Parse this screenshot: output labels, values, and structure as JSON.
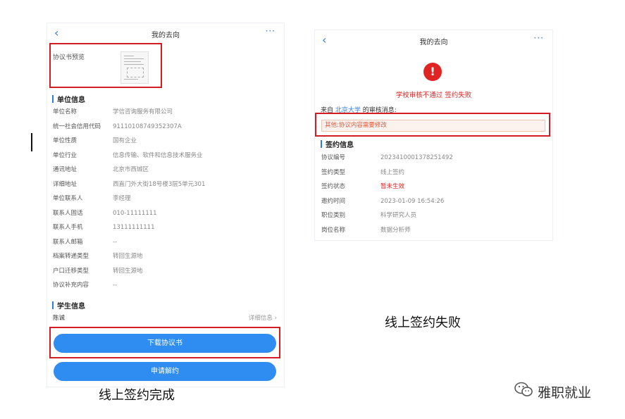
{
  "left": {
    "nav": {
      "back": "‹",
      "title": "我的去向",
      "more": "···"
    },
    "preview_label": "协议书预览",
    "unit_section": "单位信息",
    "unit_fields": [
      {
        "k": "单位名称",
        "v": "学信咨询服务有限公司"
      },
      {
        "k": "统一社会信用代码",
        "v": "91110108749352307A"
      },
      {
        "k": "单位性质",
        "v": "国有企业"
      },
      {
        "k": "单位行业",
        "v": "信息传输、软件和信息技术服务业"
      },
      {
        "k": "通讯地址",
        "v": "北京市西城区"
      },
      {
        "k": "详细地址",
        "v": "西直门外大街18号楼3层5单元301"
      },
      {
        "k": "单位联系人",
        "v": "李经理"
      },
      {
        "k": "联系人固话",
        "v": "010-11111111"
      },
      {
        "k": "联系人手机",
        "v": "13111111111"
      },
      {
        "k": "联系人邮箱",
        "v": "--"
      },
      {
        "k": "档案转递类型",
        "v": "转回生源地"
      },
      {
        "k": "户口迁移类型",
        "v": "转回生源地"
      },
      {
        "k": "协议补充内容",
        "v": "--"
      }
    ],
    "student_section": "学生信息",
    "student_name": "陈诚",
    "student_detail": "详细信息 ›",
    "download_btn": "下载协议书",
    "cancel_btn": "申请解约",
    "caption": "线上签约完成"
  },
  "right": {
    "nav": {
      "back": "‹",
      "title": "我的去向",
      "more": "···"
    },
    "alert_glyph": "!",
    "fail_text": "学校审核不通过 签约失败",
    "review_prefix": "来自 ",
    "review_school": "北京大学",
    "review_suffix": " 的审核消息:",
    "review_message": "其他:协议内容需要修改",
    "sign_section": "签约信息",
    "sign_fields": [
      {
        "k": "协议编号",
        "v": "2023410001378251492"
      },
      {
        "k": "签约类型",
        "v": "线上签约"
      },
      {
        "k": "签约状态",
        "v": "暂未生效"
      },
      {
        "k": "邀约时间",
        "v": "2023-01-09 16:54:26"
      },
      {
        "k": "职位类别",
        "v": "科学研究人员"
      },
      {
        "k": "岗位名称",
        "v": "数据分析师"
      }
    ],
    "caption": "线上签约失败"
  },
  "watermark": "雅职就业",
  "colors": {
    "accent": "#2b7be8",
    "button": "#2f8df2",
    "error": "#e02323",
    "highlight": "#d41c23"
  }
}
